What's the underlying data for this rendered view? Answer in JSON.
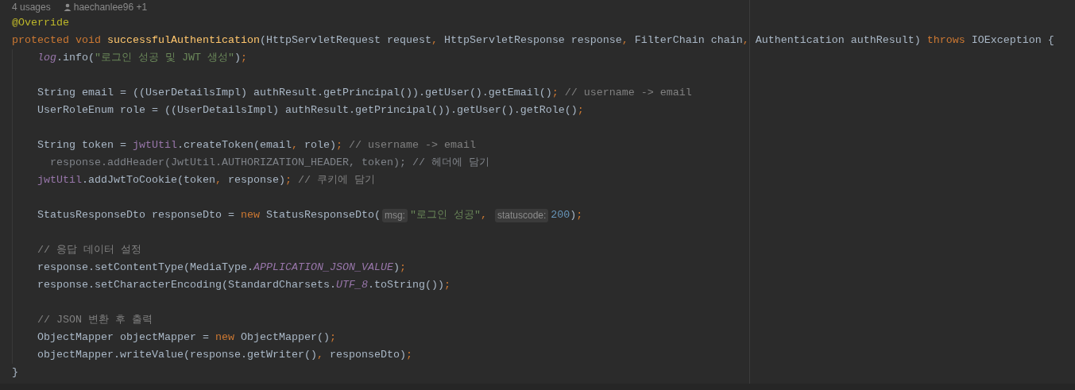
{
  "header": {
    "usages": "4 usages",
    "author": "haechanlee96 +1"
  },
  "lines": [
    {
      "kind": "code",
      "tokens": [
        {
          "text": "@Override",
          "kind": "annotation"
        }
      ]
    },
    {
      "kind": "code",
      "tokens": [
        {
          "text": "protected void ",
          "kind": "keyword"
        },
        {
          "text": "successfulAuthentication",
          "kind": "method"
        },
        {
          "text": "(HttpServletRequest request",
          "kind": "plain"
        },
        {
          "text": ", ",
          "kind": "punct"
        },
        {
          "text": "HttpServletResponse response",
          "kind": "plain"
        },
        {
          "text": ", ",
          "kind": "punct"
        },
        {
          "text": "FilterChain chain",
          "kind": "plain"
        },
        {
          "text": ", ",
          "kind": "punct"
        },
        {
          "text": "Authentication authResult) ",
          "kind": "plain"
        },
        {
          "text": "throws ",
          "kind": "keyword"
        },
        {
          "text": "IOException {",
          "kind": "plain"
        }
      ],
      "children": [
        {
          "kind": "code",
          "tokens": [
            {
              "text": "log",
              "kind": "static"
            },
            {
              "text": ".info(",
              "kind": "plain"
            },
            {
              "text": "\"로그인 성공 및 JWT 생성\"",
              "kind": "string"
            },
            {
              "text": ")",
              "kind": "plain"
            },
            {
              "text": ";",
              "kind": "punct"
            }
          ]
        },
        {
          "kind": "blank"
        },
        {
          "kind": "code",
          "tokens": [
            {
              "text": "String email = ((UserDetailsImpl) authResult.getPrincipal()).getUser().getEmail()",
              "kind": "plain"
            },
            {
              "text": "; ",
              "kind": "punct"
            },
            {
              "text": "// username -> email",
              "kind": "comment"
            }
          ]
        },
        {
          "kind": "code",
          "tokens": [
            {
              "text": "UserRoleEnum role = ((UserDetailsImpl) authResult.getPrincipal()).getUser().getRole()",
              "kind": "plain"
            },
            {
              "text": ";",
              "kind": "punct"
            }
          ]
        },
        {
          "kind": "blank"
        },
        {
          "kind": "code",
          "tokens": [
            {
              "text": "String token = ",
              "kind": "plain"
            },
            {
              "text": "jwtUtil",
              "kind": "field"
            },
            {
              "text": ".createToken(email",
              "kind": "plain"
            },
            {
              "text": ", ",
              "kind": "punct"
            },
            {
              "text": "role)",
              "kind": "plain"
            },
            {
              "text": "; ",
              "kind": "punct"
            },
            {
              "text": "// username -> email",
              "kind": "comment"
            }
          ]
        },
        {
          "kind": "code",
          "tokens": [
            {
              "text": "  response.addHeader(JwtUtil.AUTHORIZATION_HEADER, token); // 헤더에 담기",
              "kind": "dim"
            }
          ]
        },
        {
          "kind": "code",
          "tokens": [
            {
              "text": "jwtUtil",
              "kind": "field"
            },
            {
              "text": ".addJwtToCookie(token",
              "kind": "plain"
            },
            {
              "text": ", ",
              "kind": "punct"
            },
            {
              "text": "response)",
              "kind": "plain"
            },
            {
              "text": "; ",
              "kind": "punct"
            },
            {
              "text": "// 쿠키에 담기",
              "kind": "comment"
            }
          ]
        },
        {
          "kind": "blank"
        },
        {
          "kind": "code",
          "tokens": [
            {
              "text": "StatusResponseDto responseDto = ",
              "kind": "plain"
            },
            {
              "text": "new ",
              "kind": "keyword"
            },
            {
              "text": "StatusResponseDto(",
              "kind": "plain"
            },
            {
              "text": "msg:",
              "kind": "hint"
            },
            {
              "text": "\"로그인 성공\"",
              "kind": "string"
            },
            {
              "text": ", ",
              "kind": "punct"
            },
            {
              "text": "statuscode:",
              "kind": "hint"
            },
            {
              "text": "200",
              "kind": "number"
            },
            {
              "text": ")",
              "kind": "plain"
            },
            {
              "text": ";",
              "kind": "punct"
            }
          ]
        },
        {
          "kind": "blank"
        },
        {
          "kind": "code",
          "tokens": [
            {
              "text": "// 응답 데이터 설정",
              "kind": "comment"
            }
          ]
        },
        {
          "kind": "code",
          "tokens": [
            {
              "text": "response.setContentType(MediaType.",
              "kind": "plain"
            },
            {
              "text": "APPLICATION_JSON_VALUE",
              "kind": "static"
            },
            {
              "text": ")",
              "kind": "plain"
            },
            {
              "text": ";",
              "kind": "punct"
            }
          ]
        },
        {
          "kind": "code",
          "tokens": [
            {
              "text": "response.setCharacterEncoding(StandardCharsets.",
              "kind": "plain"
            },
            {
              "text": "UTF_8",
              "kind": "static"
            },
            {
              "text": ".toString())",
              "kind": "plain"
            },
            {
              "text": ";",
              "kind": "punct"
            }
          ]
        },
        {
          "kind": "blank"
        },
        {
          "kind": "code",
          "tokens": [
            {
              "text": "// JSON 변환 후 출력",
              "kind": "comment"
            }
          ]
        },
        {
          "kind": "code",
          "tokens": [
            {
              "text": "ObjectMapper objectMapper = ",
              "kind": "plain"
            },
            {
              "text": "new ",
              "kind": "keyword"
            },
            {
              "text": "ObjectMapper()",
              "kind": "plain"
            },
            {
              "text": ";",
              "kind": "punct"
            }
          ]
        },
        {
          "kind": "code",
          "tokens": [
            {
              "text": "objectMapper.writeValue(response.getWriter()",
              "kind": "plain"
            },
            {
              "text": ", ",
              "kind": "punct"
            },
            {
              "text": "responseDto)",
              "kind": "plain"
            },
            {
              "text": ";",
              "kind": "punct"
            }
          ]
        }
      ]
    },
    {
      "kind": "code",
      "tokens": [
        {
          "text": "}",
          "kind": "plain"
        }
      ]
    }
  ]
}
